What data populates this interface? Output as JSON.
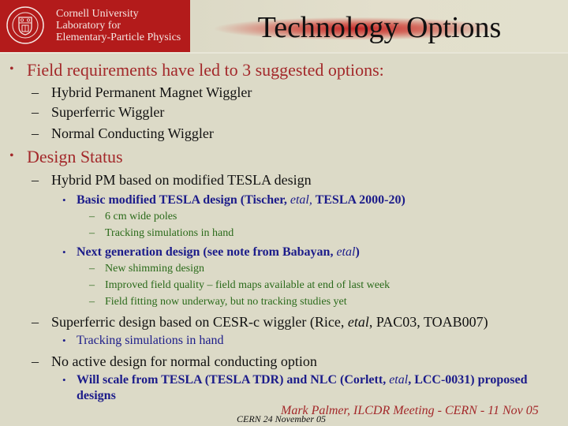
{
  "header": {
    "logo": {
      "icon": "cornell-seal-icon",
      "lines": [
        "Cornell University",
        "Laboratory for",
        "Elementary-Particle Physics"
      ]
    },
    "title": "Technology Options"
  },
  "body": {
    "section1": {
      "heading": "Field requirements have led to 3 suggested options:",
      "items": [
        "Hybrid Permanent Magnet Wiggler",
        "Superferric Wiggler",
        "Normal Conducting Wiggler"
      ]
    },
    "section2": {
      "heading": "Design Status",
      "hybrid": {
        "label": "Hybrid PM based on modified TESLA design",
        "basic": {
          "pre": "Basic modified TESLA design (Tischer, ",
          "etal": "etal,",
          "post": " TESLA 2000-20)",
          "items": [
            "6 cm wide poles",
            "Tracking simulations in hand"
          ]
        },
        "next": {
          "pre": "Next generation design (see note from Babayan, ",
          "etal": "etal",
          "post": ")",
          "items": [
            "New shimming design",
            "Improved field quality – field maps available at end of last week",
            "Field fitting now underway, but no tracking studies yet"
          ]
        }
      },
      "superferric": {
        "pre": "Superferric design based on CESR-c wiggler (Rice, ",
        "etal": "etal",
        "post": ", PAC03, TOAB007)",
        "items": [
          "Tracking simulations in hand"
        ]
      },
      "normal": {
        "label": "No active design for normal conducting option",
        "scale": {
          "pre": "Will scale from TESLA (TESLA TDR) and NLC (Corlett, ",
          "etal": "etal",
          "post": ", LCC-0031) proposed",
          "line2": "designs"
        }
      }
    }
  },
  "footer": {
    "presenter": "Mark Palmer, ILCDR Meeting - CERN - 11 Nov 05",
    "date": "CERN 24 November 05"
  },
  "bullets": {
    "l1": "•",
    "l2": "–",
    "l3": "•",
    "l4": "–"
  }
}
